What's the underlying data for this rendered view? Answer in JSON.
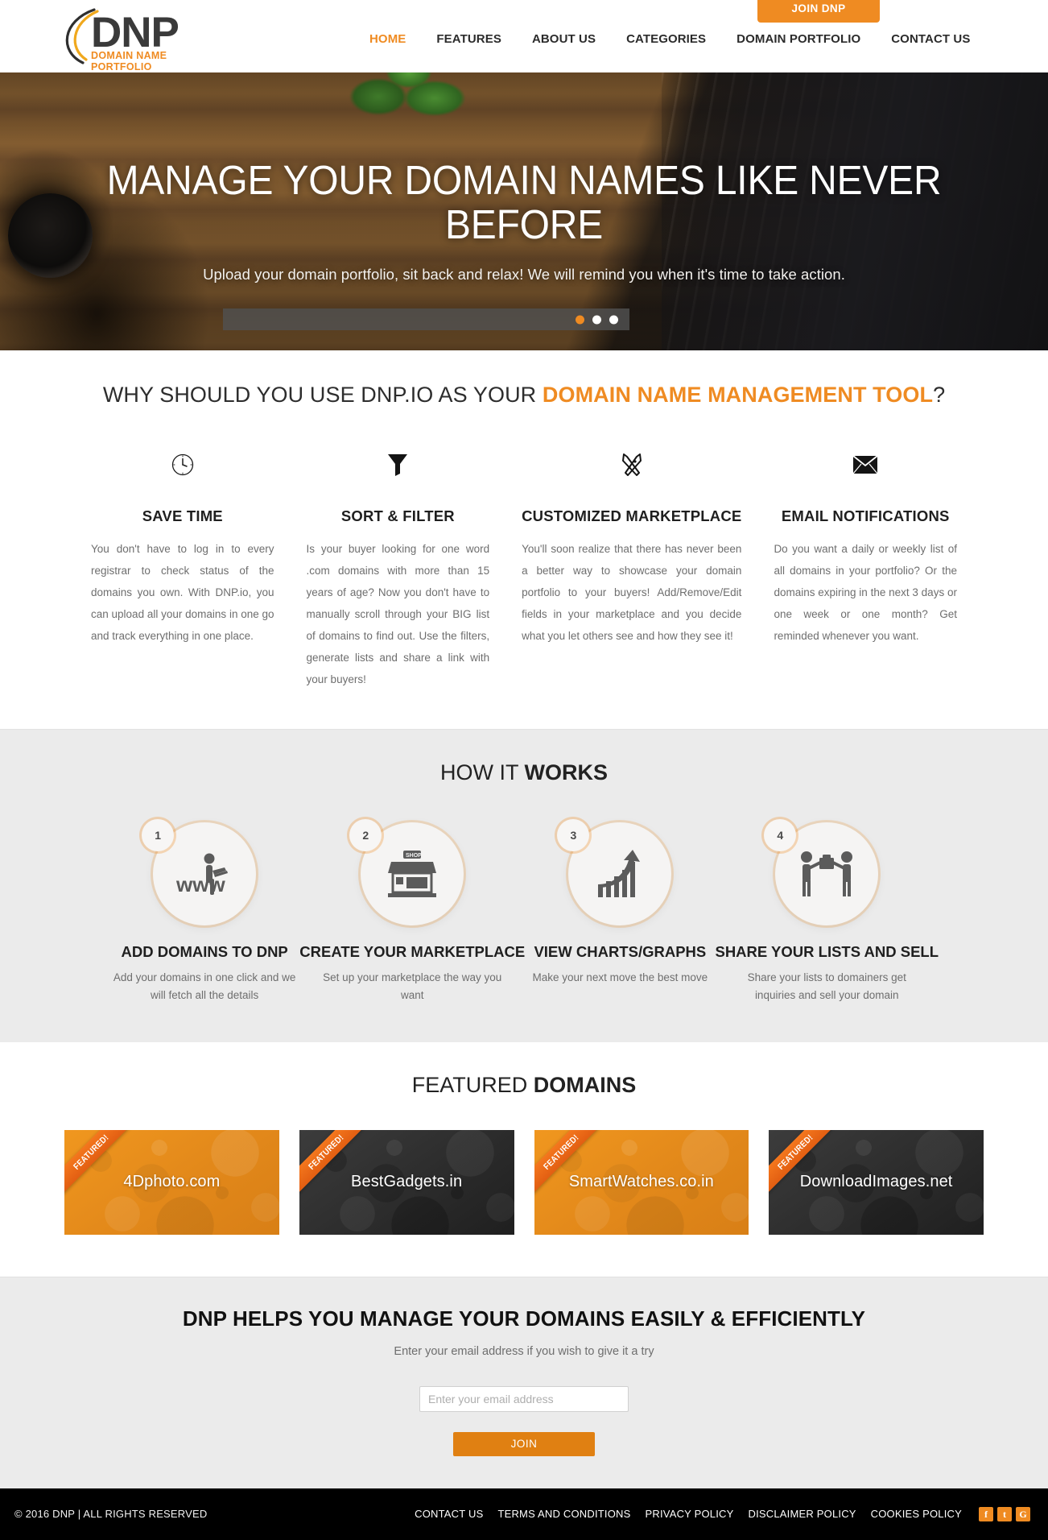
{
  "header": {
    "logo": {
      "mark": "DNP",
      "tagline": "DOMAIN NAME PORTFOLIO"
    },
    "join_button": "JOIN DNP",
    "nav": [
      {
        "label": "HOME",
        "active": true
      },
      {
        "label": "FEATURES",
        "active": false
      },
      {
        "label": "ABOUT US",
        "active": false
      },
      {
        "label": "CATEGORIES",
        "active": false
      },
      {
        "label": "DOMAIN PORTFOLIO",
        "active": false
      },
      {
        "label": "CONTACT US",
        "active": false
      }
    ]
  },
  "hero": {
    "title": "MANAGE YOUR DOMAIN NAMES LIKE NEVER BEFORE",
    "subtitle": "Upload your domain portfolio, sit back and relax! We will remind you when it's time to take action.",
    "slides": 3,
    "active_slide": 1
  },
  "why": {
    "title_plain_1": "WHY SHOULD YOU USE DNP.IO AS YOUR ",
    "title_highlight": "DOMAIN NAME MANAGEMENT TOOL",
    "title_plain_2": "?",
    "features": [
      {
        "icon": "clock-icon",
        "heading": "SAVE TIME",
        "body": "You don't have to log in to every registrar to check status of the domains you own. With DNP.io, you can upload all your domains in one go and track everything in one place."
      },
      {
        "icon": "funnel-icon",
        "heading": "SORT & FILTER",
        "body": "Is your buyer looking for one word .com domains with more than 15 years of age? Now you don't have to manually scroll through your BIG list of domains to find out. Use the filters, generate lists and share a link with your buyers!"
      },
      {
        "icon": "pencil-ruler-icon",
        "heading": "CUSTOMIZED MARKETPLACE",
        "body": "You'll soon realize that there has never been a better way to showcase your domain portfolio to your buyers! Add/Remove/Edit fields in your marketplace and you decide what you let others see and how they see it!"
      },
      {
        "icon": "envelope-icon",
        "heading": "EMAIL NOTIFICATIONS",
        "body": "Do you want a daily or weekly list of all domains in your portfolio? Or the domains expiring in the next 3 days or one week or one month? Get reminded whenever you want."
      }
    ]
  },
  "how": {
    "title_light": "HOW IT ",
    "title_bold": "WORKS",
    "steps": [
      {
        "number": "1",
        "icon": "www-person-laptop-icon",
        "heading": "ADD DOMAINS TO DNP",
        "body": "Add your domains in one click and we will fetch all the details"
      },
      {
        "number": "2",
        "icon": "shop-storefront-icon",
        "heading": "CREATE YOUR MARKETPLACE",
        "body": "Set up your marketplace the way you want"
      },
      {
        "number": "3",
        "icon": "growth-chart-arrow-icon",
        "heading": "VIEW CHARTS/GRAPHS",
        "body": "Make your next move the best move"
      },
      {
        "number": "4",
        "icon": "handshake-deal-icon",
        "heading": "SHARE YOUR LISTS AND SELL",
        "body": "Share your lists to domainers get inquiries and sell your domain"
      }
    ]
  },
  "featured": {
    "title_light": "FEATURED ",
    "title_bold": "DOMAINS",
    "ribbon_label": "FEATURED!",
    "cards": [
      {
        "domain": "4Dphoto.com",
        "theme": "orange"
      },
      {
        "domain": "BestGadgets.in",
        "theme": "dark"
      },
      {
        "domain": "SmartWatches.co.in",
        "theme": "orange"
      },
      {
        "domain": "DownloadImages.net",
        "theme": "dark"
      }
    ]
  },
  "cta": {
    "title": "DNP HELPS YOU MANAGE YOUR DOMAINS EASILY & EFFICIENTLY",
    "subtitle": "Enter your email address if you wish to give it a try",
    "input_placeholder": "Enter your email address",
    "input_value": "",
    "button": "JOIN"
  },
  "footer": {
    "copyright": "© 2016 DNP | ALL RIGHTS RESERVED",
    "links": [
      "CONTACT US",
      "TERMS AND CONDITIONS",
      "PRIVACY POLICY",
      "DISCLAIMER POLICY",
      "COOKIES POLICY"
    ],
    "social": [
      {
        "name": "facebook-icon",
        "glyph": "f"
      },
      {
        "name": "twitter-icon",
        "glyph": "t"
      },
      {
        "name": "google-plus-icon",
        "glyph": "G"
      }
    ]
  },
  "colors": {
    "accent": "#ef8b22",
    "accent_dark": "#e08012",
    "text": "#2d2d2d",
    "muted": "#6e6e6e",
    "section_grey": "#ebebeb",
    "footer_bg": "#000000"
  }
}
